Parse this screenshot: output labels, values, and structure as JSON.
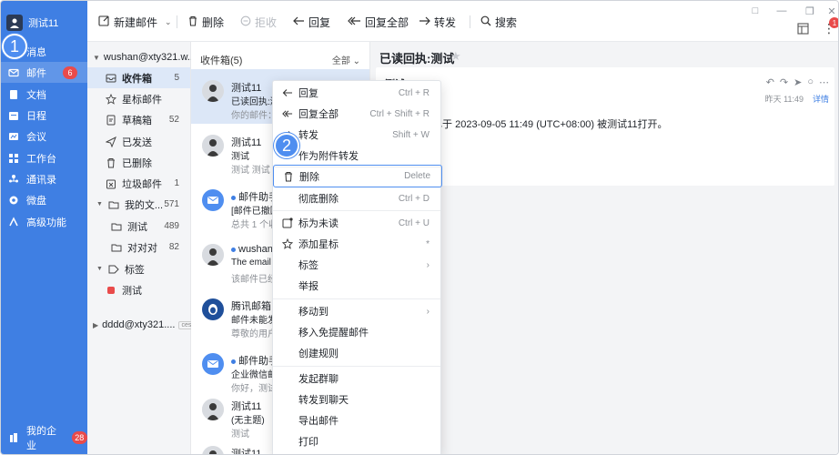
{
  "nav": {
    "user": "测试11",
    "items": [
      {
        "label": "消息",
        "icon": "chat-icon"
      },
      {
        "label": "邮件",
        "icon": "mail-icon",
        "badge": "6"
      },
      {
        "label": "文档",
        "icon": "document-icon"
      },
      {
        "label": "日程",
        "icon": "calendar-icon"
      },
      {
        "label": "会议",
        "icon": "meeting-icon"
      },
      {
        "label": "工作台",
        "icon": "grid-icon"
      },
      {
        "label": "通讯录",
        "icon": "contacts-icon"
      },
      {
        "label": "微盘",
        "icon": "drive-icon"
      },
      {
        "label": "高级功能",
        "icon": "advanced-icon"
      }
    ],
    "bottom_label": "我的企业",
    "bottom_badge": "28"
  },
  "steps": {
    "one": "1",
    "two": "2"
  },
  "toolbar": {
    "new_mail": "新建邮件",
    "delete": "删除",
    "reject": "拒收",
    "reply": "回复",
    "reply_all": "回复全部",
    "forward": "转发",
    "search": "搜索",
    "notif_badge": "1"
  },
  "folders": {
    "account1": "wushan@xty321.w...",
    "items": [
      {
        "label": "收件箱",
        "count": "5"
      },
      {
        "label": "星标邮件",
        "count": ""
      },
      {
        "label": "草稿箱",
        "count": "52"
      },
      {
        "label": "已发送",
        "count": ""
      },
      {
        "label": "已删除",
        "count": ""
      },
      {
        "label": "垃圾邮件",
        "count": "1"
      },
      {
        "label": "我的文...",
        "count": "571"
      },
      {
        "label": "测试",
        "count": "489"
      },
      {
        "label": "对对对",
        "count": "82"
      },
      {
        "label": "标签",
        "count": ""
      },
      {
        "label": "测试",
        "count": ""
      }
    ],
    "account2": "dddd@xty321....",
    "account2_tag": "ces"
  },
  "list": {
    "header": "收件箱(5)",
    "filter": "全部",
    "messages": [
      {
        "from": "测试11",
        "subject": "已读回执:测",
        "preview": "你的邮件："
      },
      {
        "from": "测试11",
        "subject": "测试",
        "preview": "测试 测试"
      },
      {
        "from": "邮件助手",
        "subject": "[邮件已撤回",
        "preview": "总共 1 个收"
      },
      {
        "from": "wushan",
        "subject": "The email",
        "preview": "该邮件已经"
      },
      {
        "from": "腾讯邮箱",
        "subject": "邮件未能发",
        "preview": "尊敬的用户"
      },
      {
        "from": "邮件助手",
        "subject": "企业微信邮",
        "preview": "你好，测试"
      },
      {
        "from": "测试11",
        "subject": "(无主题)",
        "preview": "测试"
      },
      {
        "from": "测试11",
        "subject": "",
        "preview": ""
      }
    ]
  },
  "reader": {
    "title": "已读回执:测试",
    "sender": "测试11",
    "time": "昨天 11:49",
    "detail_link": "详情",
    "body": "试 已于 2023-09-05 11:49 (UTC+08:00) 被测试11打开。"
  },
  "menu": {
    "items": [
      {
        "label": "回复",
        "shortcut": "Ctrl + R",
        "icon": "reply-icon"
      },
      {
        "label": "回复全部",
        "shortcut": "Ctrl + Shift + R",
        "icon": "reply-all-icon"
      },
      {
        "label": "转发",
        "shortcut": "Shift + W",
        "icon": "forward-icon"
      },
      {
        "label": "作为附件转发",
        "shortcut": "",
        "icon": ""
      },
      {
        "label": "删除",
        "shortcut": "Delete",
        "icon": "trash-icon"
      },
      {
        "label": "彻底删除",
        "shortcut": "Ctrl + D",
        "icon": ""
      },
      {
        "label": "标为未读",
        "shortcut": "Ctrl + U",
        "icon": "unread-icon"
      },
      {
        "label": "添加星标",
        "shortcut": "*",
        "icon": "star-icon"
      },
      {
        "label": "标签",
        "shortcut": "",
        "icon": ""
      },
      {
        "label": "举报",
        "shortcut": "",
        "icon": ""
      },
      {
        "label": "移动到",
        "shortcut": "",
        "icon": ""
      },
      {
        "label": "移入免提醒邮件",
        "shortcut": "",
        "icon": ""
      },
      {
        "label": "创建规则",
        "shortcut": "",
        "icon": ""
      },
      {
        "label": "发起群聊",
        "shortcut": "",
        "icon": ""
      },
      {
        "label": "转发到聊天",
        "shortcut": "",
        "icon": ""
      },
      {
        "label": "导出邮件",
        "shortcut": "",
        "icon": ""
      },
      {
        "label": "打印",
        "shortcut": "",
        "icon": ""
      }
    ]
  },
  "colors": {
    "accent": "#3f7fe3",
    "badge": "#e94b4b",
    "highlight": "#4f8ef0"
  }
}
